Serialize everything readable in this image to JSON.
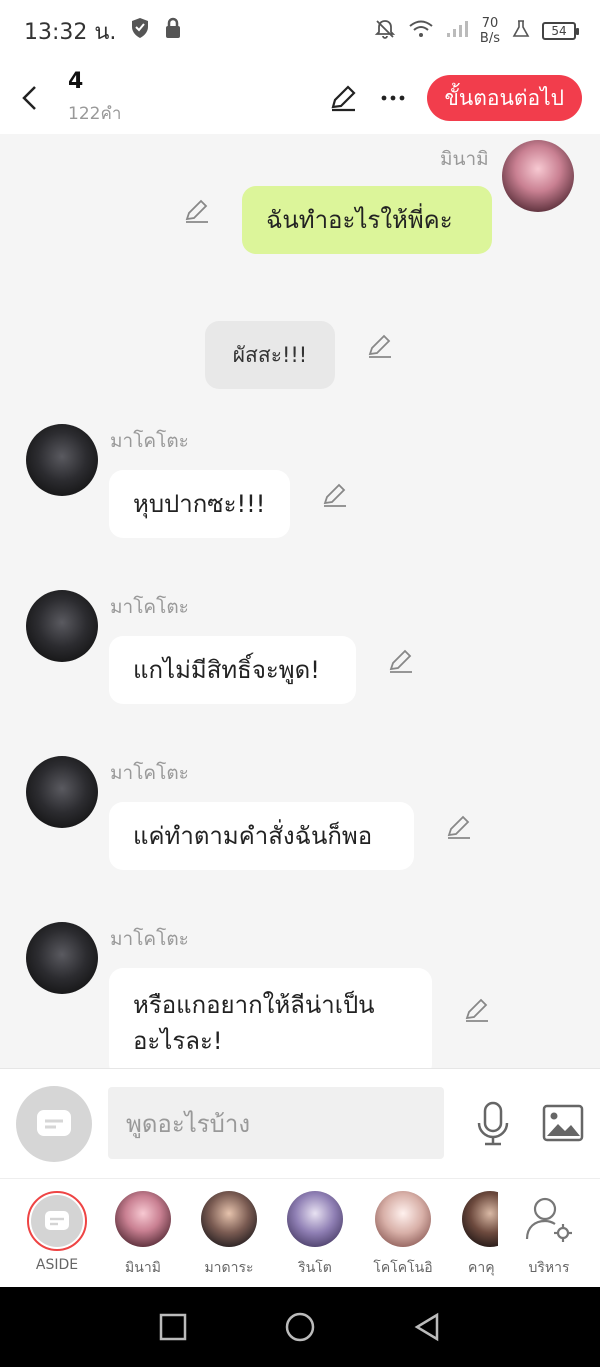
{
  "status_bar": {
    "time": "13:32 น.",
    "net_speed_value": "70",
    "net_speed_unit": "B/s",
    "battery": "54"
  },
  "header": {
    "title": "4",
    "subtitle": "122คำ",
    "next_button": "ขั้นตอนต่อไป"
  },
  "messages": [
    {
      "type": "mine",
      "sender": "มินามิ",
      "text": "ฉันทำอะไรให้พี่คะ"
    },
    {
      "type": "narration",
      "text": "ผัสสะ!!!"
    },
    {
      "type": "other",
      "sender": "มาโคโตะ",
      "text": "หุบปากซะ!!!"
    },
    {
      "type": "other",
      "sender": "มาโคโตะ",
      "text": "แกไม่มีสิทธิ์จะพูด!"
    },
    {
      "type": "other",
      "sender": "มาโคโตะ",
      "text": "แค่ทำตามคำสั่งฉันก็พอ"
    },
    {
      "type": "other",
      "sender": "มาโคโตะ",
      "text_line1": "หรือแกอยากให้ลีน่าเป็น",
      "text_line2": "อะไรละ!"
    }
  ],
  "input": {
    "placeholder": "พูดอะไรบ้าง"
  },
  "characters": [
    {
      "label": "ASIDE"
    },
    {
      "label": "มินามิ"
    },
    {
      "label": "มาดาระ"
    },
    {
      "label": "รินโต"
    },
    {
      "label": "โคโคโนอิ"
    },
    {
      "label": "คาคุ"
    },
    {
      "label": "บริหาร"
    }
  ],
  "colors": {
    "accent": "#f23d4c",
    "my_bubble": "#dcf59a",
    "background": "#f5f5f5"
  }
}
